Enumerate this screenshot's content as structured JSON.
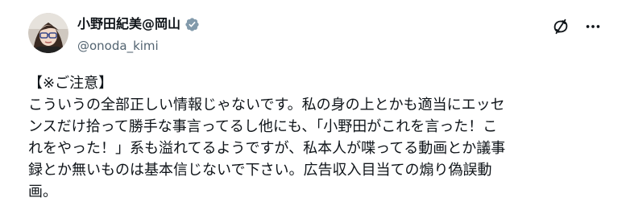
{
  "author": {
    "display_name": "小野田紀美@岡山",
    "handle": "@onoda_kimi",
    "verified": true,
    "verified_badge_color": "#829aab"
  },
  "actions": {
    "grok_icon": "grok-icon",
    "more_icon": "more-icon"
  },
  "post": {
    "lines": [
      "【※ご注意】",
      "こういうの全部正しい情報じゃないです。私の身の上とかも適当にエッセ",
      "ンスだけ拾って勝手な事言ってるし他にも、「小野田がこれを言った！こ",
      "れをやった！」系も溢れてるようですが、私本人が喋ってる動画とか議事",
      "録とか無いものは基本信じないで下さい。広告収入目当ての煽り偽誤動",
      "画。"
    ]
  },
  "colors": {
    "text": "#0f1419",
    "secondary": "#536471",
    "background": "#ffffff"
  }
}
